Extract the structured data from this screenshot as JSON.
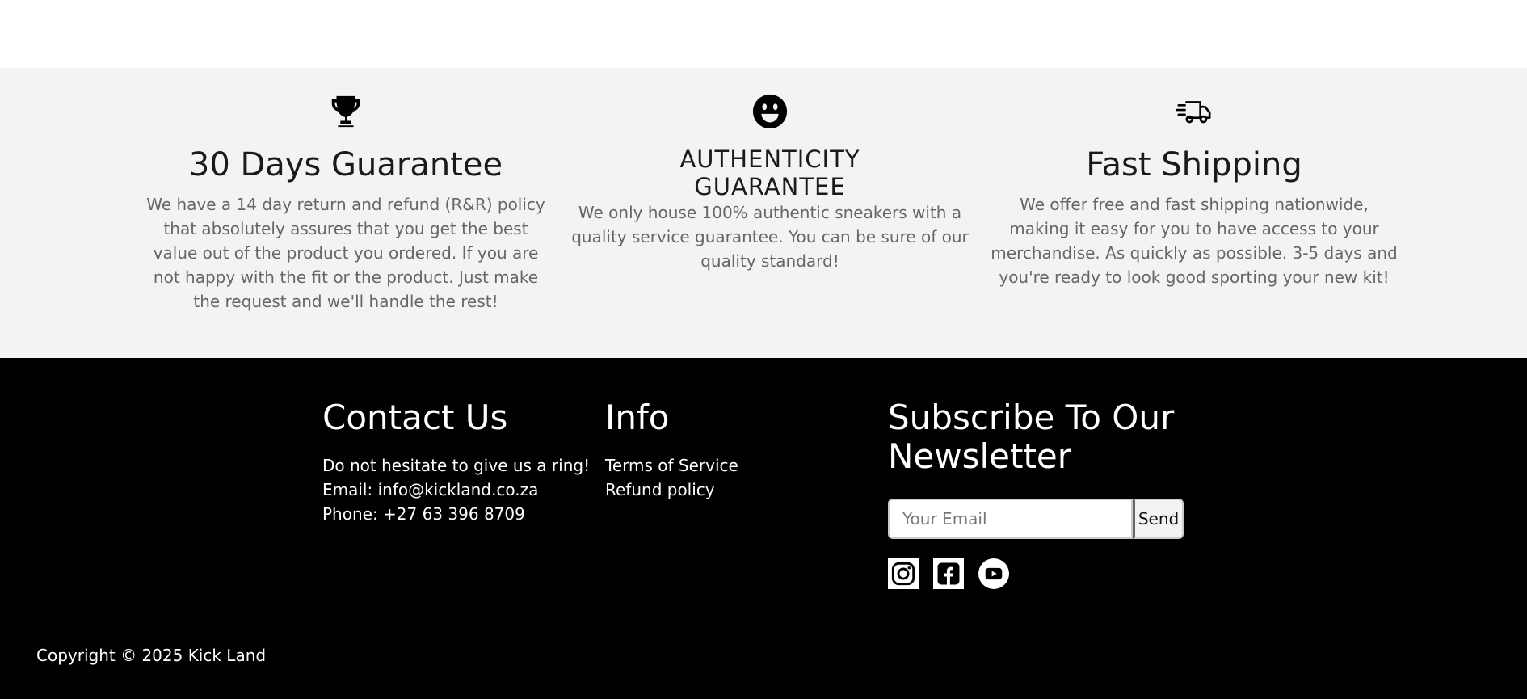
{
  "features": [
    {
      "icon": "trophy-icon",
      "title": "30 Days Guarantee",
      "text": "We have a 14 day return and refund (R&R) policy that absolutely assures that you get the best value out of the product you ordered. If you are not happy with the fit or the product. Just make the request and we'll handle the rest!"
    },
    {
      "icon": "smiley-icon",
      "title": "AUTHENTICITY GUARANTEE",
      "text": "We only house 100% authentic sneakers with a quality service guarantee. You can be sure of our quality standard!"
    },
    {
      "icon": "delivery-truck-icon",
      "title": "Fast Shipping",
      "text": "We offer free and fast shipping nationwide, making it easy for you to have access to your merchandise. As quickly as possible. 3-5 days and you're ready to look good sporting your new kit!"
    }
  ],
  "footer": {
    "contact": {
      "heading": "Contact Us",
      "line1": "Do not hesitate to give us a ring!",
      "email": "Email: info@kickland.co.za",
      "phone": "Phone: +27 63 396 8709"
    },
    "info": {
      "heading": "Info",
      "links": [
        "Terms of Service",
        "Refund policy"
      ]
    },
    "newsletter": {
      "heading": "Subscribe To Our Newsletter",
      "placeholder": "Your Email",
      "button": "Send"
    },
    "socials": [
      "instagram-icon",
      "facebook-icon",
      "youtube-icon"
    ],
    "copyright": "Copyright © 2025 Kick Land"
  }
}
